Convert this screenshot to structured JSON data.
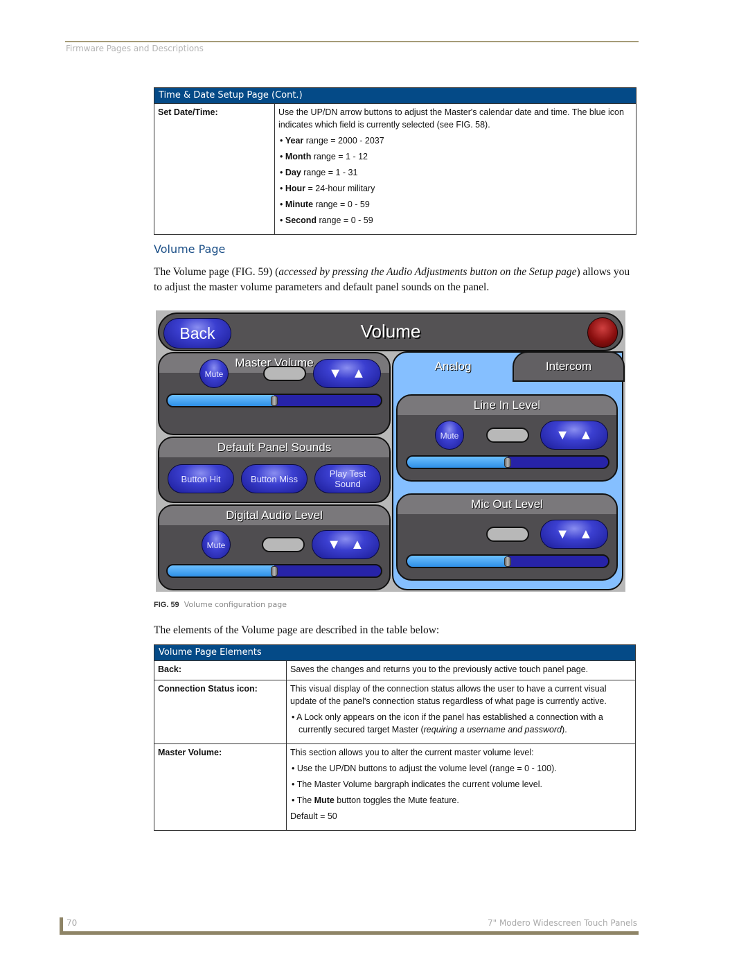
{
  "header": {
    "running_head": "Firmware Pages and Descriptions"
  },
  "table1": {
    "title": "Time & Date Setup Page (Cont.)",
    "rows": [
      {
        "key": "Set Date/Time:",
        "text": "Use the UP/DN arrow buttons to adjust the Master's calendar date and time. The blue icon indicates which field is currently selected (see FIG. 58).",
        "bullets": [
          {
            "bold": "Year",
            "rest": " range = 2000 - 2037"
          },
          {
            "bold": "Month",
            "rest": " range = 1 - 12"
          },
          {
            "bold": "Day",
            "rest": " range = 1 - 31"
          },
          {
            "bold": "Hour",
            "rest": " = 24-hour military"
          },
          {
            "bold": "Minute",
            "rest": " range = 0 - 59"
          },
          {
            "bold": "Second",
            "rest": " range = 0 - 59"
          }
        ]
      }
    ]
  },
  "section": {
    "heading": "Volume Page",
    "intro_a": "The Volume page (FIG. 59) (",
    "intro_italic": "accessed by pressing the Audio Adjustments button on the Setup page",
    "intro_b": ") allows you to adjust the master volume parameters and default panel sounds on the panel."
  },
  "panel": {
    "back_label": "Back",
    "title": "Volume",
    "status_color": "#8a0f0f",
    "master_volume": {
      "title": "Master Volume",
      "mute_label": "Mute",
      "level_percent": 50
    },
    "default_sounds": {
      "title": "Default Panel Sounds",
      "buttons": [
        "Button Hit",
        "Button Miss",
        "Play Test Sound"
      ]
    },
    "digital_audio": {
      "title": "Digital Audio Level",
      "mute_label": "Mute",
      "level_percent": 50
    },
    "tabs": {
      "active": "Analog",
      "inactive": "Intercom"
    },
    "line_in": {
      "title": "Line In Level",
      "mute_label": "Mute",
      "level_percent": 50
    },
    "mic_out": {
      "title": "Mic Out Level",
      "level_percent": 50
    },
    "down_arrow": "▼",
    "up_arrow": "▲"
  },
  "figure": {
    "label": "FIG. 59",
    "caption": "Volume configuration page"
  },
  "after_figure_text": "The elements of the Volume page are described in the table below:",
  "table2": {
    "title": "Volume Page Elements",
    "back": {
      "key": "Back:",
      "text": "Saves the changes and returns you to the previously active touch panel page."
    },
    "connection": {
      "key": "Connection Status icon:",
      "text": "This visual display of the connection status allows the user to have a current visual update of the panel's connection status regardless of what page is currently active.",
      "bullet_a": "A Lock only appears on the icon if the panel has established a connection with a currently secured target Master (",
      "bullet_italic": "requiring a username and password",
      "bullet_b": ")."
    },
    "master": {
      "key": "Master Volume:",
      "text": "This section allows you to alter the current master volume level:",
      "bullet1": "Use the UP/DN buttons to adjust the volume level (range = 0 - 100).",
      "bullet2": "The Master Volume bargraph indicates the current volume level.",
      "bullet3_a": "The ",
      "bullet3_bold": "Mute",
      "bullet3_b": " button toggles the Mute feature.",
      "default": "Default = 50"
    }
  },
  "footer": {
    "page_number": "70",
    "book_title": "7\" Modero Widescreen Touch Panels"
  }
}
